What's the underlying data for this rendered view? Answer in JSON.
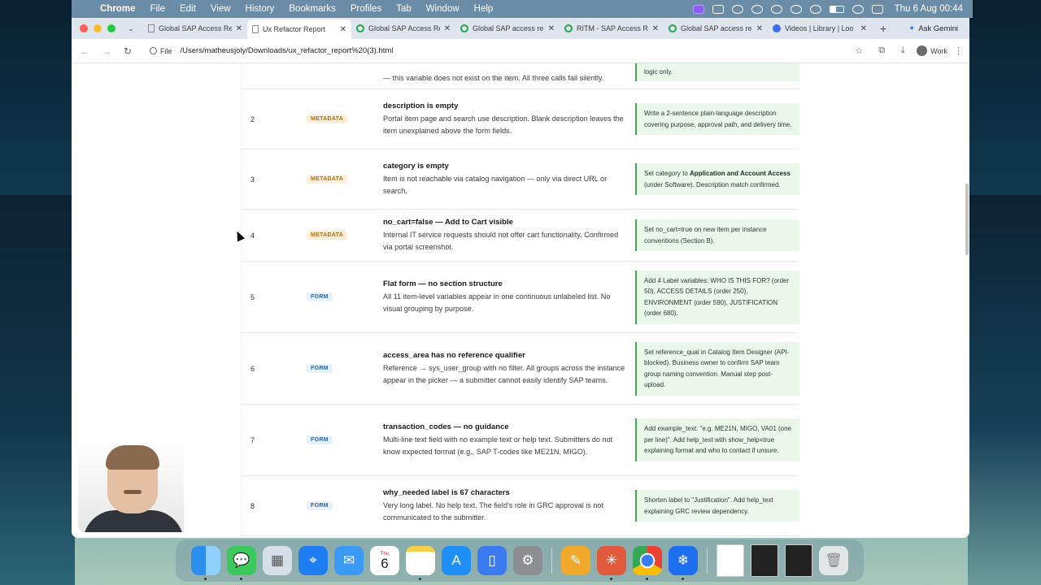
{
  "menubar": {
    "app_name": "Chrome",
    "items": [
      "File",
      "Edit",
      "View",
      "History",
      "Bookmarks",
      "Profiles",
      "Tab",
      "Window",
      "Help"
    ],
    "clock": "Thu 6 Aug  00:44"
  },
  "browser": {
    "tabs": [
      {
        "label": "Global SAP Access Re",
        "icon": "document-icon",
        "active": false
      },
      {
        "label": "Ux Refactor Report",
        "icon": "document-icon",
        "active": true
      },
      {
        "label": "Global SAP Access Re",
        "icon": "servicenow-icon",
        "active": false
      },
      {
        "label": "Global SAP access re",
        "icon": "servicenow-icon",
        "active": false
      },
      {
        "label": "RITM - SAP Access Re",
        "icon": "servicenow-icon",
        "active": false
      },
      {
        "label": "Global SAP access re",
        "icon": "servicenow-icon",
        "active": false
      },
      {
        "label": "Videos | Library | Loo",
        "icon": "loom-icon",
        "active": false
      }
    ],
    "ask_gemini": "Ask Gemini",
    "address_chip": "File",
    "url": "/Users/matheusjoly/Downloads/ux_refactor_report%20(3).html",
    "profile_label": "Work"
  },
  "report": {
    "partial_row": {
      "description_tail": "— this variable does not exist on the item. All three calls fail silently.",
      "fix_tail": "logic only."
    },
    "rows": [
      {
        "number": "2",
        "category": "METADATA",
        "title": "description is empty",
        "description": "Portal item page and search use description. Blank description leaves the item unexplained above the form fields.",
        "fix": "Write a 2-sentence plain-language description covering purpose, approval path, and delivery time."
      },
      {
        "number": "3",
        "category": "METADATA",
        "title": "category is empty",
        "description": "Item is not reachable via catalog navigation — only via direct URL or search.",
        "fix_prefix": "Set category to ",
        "fix_bold": "Application and Account Access",
        "fix_suffix": " (under Software). Description match confirmed."
      },
      {
        "number": "4",
        "category": "METADATA",
        "title": "no_cart=false — Add to Cart visible",
        "description": "Internal IT service requests should not offer cart functionality. Confirmed via portal screenshot.",
        "fix": "Set no_cart=true on new item per instance conventions (Section B)."
      },
      {
        "number": "5",
        "category": "FORM",
        "title": "Flat form — no section structure",
        "description": "All 11 item-level variables appear in one continuous unlabeled list. No visual grouping by purpose.",
        "fix": "Add 4 Label variables: WHO IS THIS FOR? (order 50), ACCESS DETAILS (order 250), ENVIRONMENT (order 590), JUSTIFICATION (order 680)."
      },
      {
        "number": "6",
        "category": "FORM",
        "title": "access_area has no reference qualifier",
        "description": "Reference → sys_user_group with no filter. All groups across the instance appear in the picker — a submitter cannot easily identify SAP teams.",
        "fix": "Set reference_qual in Catalog Item Designer (API-blocked). Business owner to confirm SAP team group naming convention. Manual step post-upload."
      },
      {
        "number": "7",
        "category": "FORM",
        "title": "transaction_codes — no guidance",
        "description": "Multi-line text field with no example text or help text. Submitters do not know expected format (e.g., SAP T-codes like ME21N, MIGO).",
        "fix": "Add example_text: \"e.g. ME21N, MIGO, VA01 (one per line)\". Add help_text with show_help=true explaining format and who to contact if unsure."
      },
      {
        "number": "8",
        "category": "FORM",
        "title": "why_needed label is 67 characters",
        "description": "Very long label. No help text. The field's role in GRC approval is not communicated to the submitter.",
        "fix": "Shorten label to \"Justification\". Add help_text explaining GRC review dependency."
      }
    ]
  },
  "dock": {
    "calendar_day_name": "Thu",
    "calendar_day_number": "6",
    "apps": [
      "Finder",
      "Messages",
      "Launchpad",
      "Safari",
      "Mail",
      "Calendar",
      "Notes",
      "App Store",
      "iPhone Mirroring",
      "System Settings",
      "Pages",
      "Claude",
      "Google Chrome",
      "Snowflake",
      "Documents",
      "Screenshots",
      "Trash"
    ]
  },
  "colors": {
    "metadata_tag_bg": "#fdf0db",
    "metadata_tag_fg": "#b46c12",
    "form_tag_bg": "#e9f1fb",
    "form_tag_fg": "#2a64b0",
    "fix_bg": "#eaf7ea",
    "fix_border": "#3fae52"
  }
}
